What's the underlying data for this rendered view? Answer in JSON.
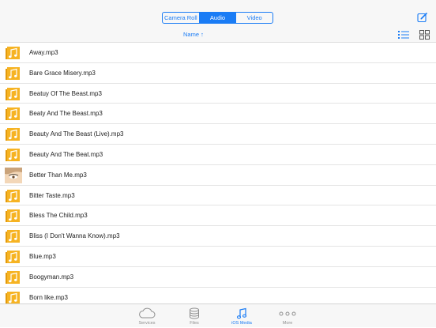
{
  "segments": [
    {
      "label": "Camera Roll",
      "active": false
    },
    {
      "label": "Audio",
      "active": true
    },
    {
      "label": "Video",
      "active": false
    }
  ],
  "sort": {
    "label": "Name ↑"
  },
  "files": [
    {
      "name": "Away.mp3",
      "icon": "music-file-icon"
    },
    {
      "name": "Bare Grace Misery.mp3",
      "icon": "music-file-icon"
    },
    {
      "name": "Beatuy Of The Beast.mp3",
      "icon": "music-file-icon"
    },
    {
      "name": "Beaty And The Beast.mp3",
      "icon": "music-file-icon"
    },
    {
      "name": "Beauty And The Beast (Live).mp3",
      "icon": "music-file-icon"
    },
    {
      "name": "Beauty And The Beat.mp3",
      "icon": "music-file-icon"
    },
    {
      "name": "Better Than Me.mp3",
      "icon": "album-art-thumbnail"
    },
    {
      "name": "Bitter Taste.mp3",
      "icon": "music-file-icon"
    },
    {
      "name": "Bless The Child.mp3",
      "icon": "music-file-icon"
    },
    {
      "name": "Bliss (I Don't Wanna Know).mp3",
      "icon": "music-file-icon"
    },
    {
      "name": "Blue.mp3",
      "icon": "music-file-icon"
    },
    {
      "name": "Boogyman.mp3",
      "icon": "music-file-icon"
    },
    {
      "name": "Born like.mp3",
      "icon": "music-file-icon"
    }
  ],
  "tabs": [
    {
      "label": "Services",
      "icon": "cloud-icon",
      "active": false
    },
    {
      "label": "Files",
      "icon": "database-icon",
      "active": false
    },
    {
      "label": "iOS Media",
      "icon": "music-note-icon",
      "active": true
    },
    {
      "label": "More",
      "icon": "more-dots-icon",
      "active": false
    }
  ],
  "colors": {
    "accent": "#1a7cf5",
    "file_icon": "#f6b322"
  }
}
